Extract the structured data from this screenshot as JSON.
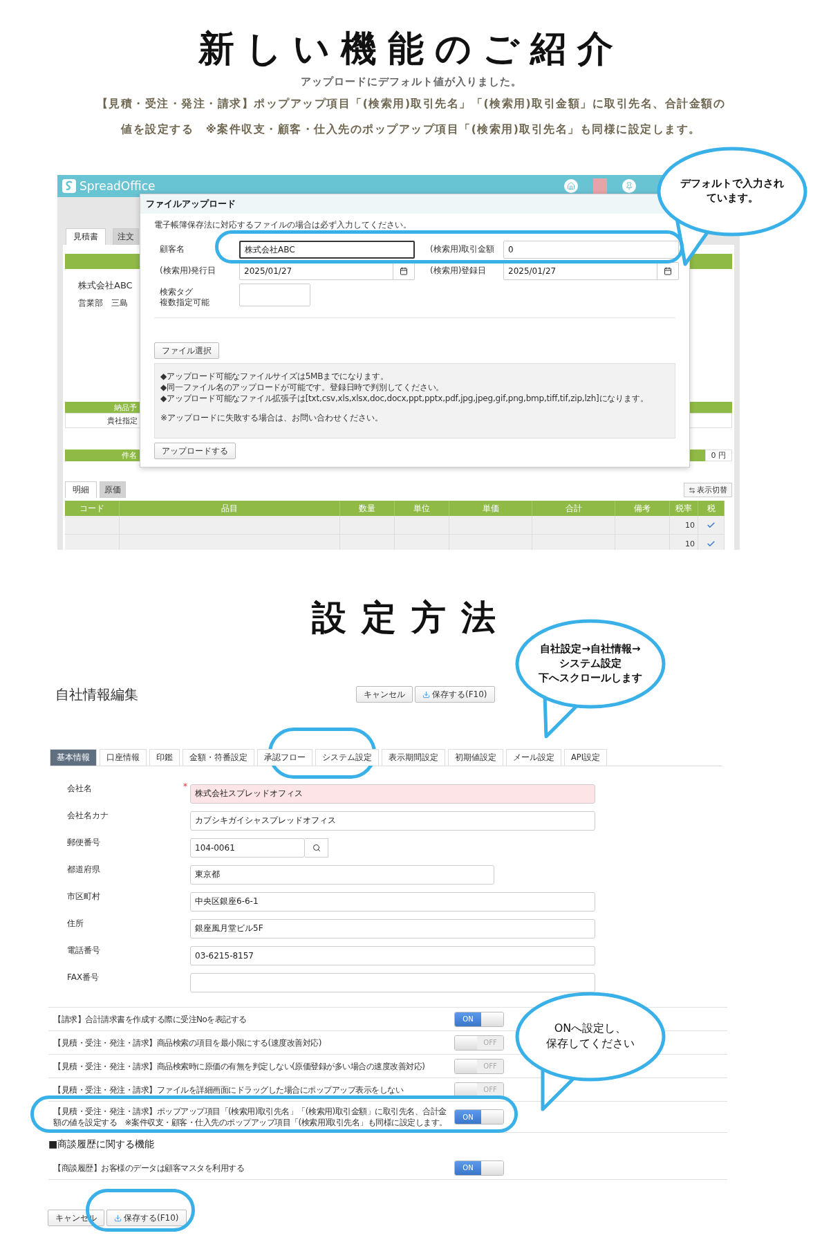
{
  "header": {
    "title": "新しい機能のご紹介",
    "subtitle": "アップロードにデフォルト値が入りました。",
    "description": [
      "【見積・受注・発注・請求】ポップアップ項目「(検索用)取引先名」「(検索用)取引金額」に取引先名、合計金額の",
      "値を設定する　※案件収支・顧客・仕入先のポップアップ項目「(検索用)取引先名」も同様に設定します。"
    ]
  },
  "upload_screenshot": {
    "app": {
      "logo": "SpreadOffice",
      "doc_tabs": [
        {
          "label": "見積書",
          "selected": true
        },
        {
          "label": "注文",
          "selected": false
        }
      ],
      "customer": "株式会社ABC",
      "department": "営業部　三島",
      "delivery_label": "納品予",
      "delivery_value": "貴社指定",
      "subject_label": "件名",
      "amount": "0 円",
      "detail_tabs": [
        {
          "label": "明細",
          "selected": true
        },
        {
          "label": "原価",
          "selected": false
        }
      ],
      "switch_button": "表示切替",
      "table": {
        "columns": [
          "コード",
          "品目",
          "数量",
          "単位",
          "単価",
          "合計",
          "備考",
          "税率",
          "税"
        ],
        "rows": [
          {
            "tax_rate": "10",
            "taxed": true
          },
          {
            "tax_rate": "10",
            "taxed": true
          }
        ]
      }
    },
    "modal": {
      "title": "ファイルアップロード",
      "notice": "電子帳簿保存法に対応するファイルの場合は必ず入力してください。",
      "fields": [
        {
          "kind": "text",
          "label": "顧客名",
          "value": "株式会社ABC",
          "focused": true
        },
        {
          "kind": "text",
          "label": "(検索用)取引金額",
          "value": "0",
          "focused": false
        },
        {
          "kind": "date",
          "label": "(検索用)発行日",
          "value": "2025/01/27",
          "focused": false
        },
        {
          "kind": "date",
          "label": "(検索用)登録日",
          "value": "2025/01/27",
          "focused": false
        },
        {
          "kind": "tag",
          "label_lines": [
            "検索タグ",
            "複数指定可能"
          ],
          "focused": false
        }
      ],
      "file_button": "ファイル選択",
      "info_lines": [
        "◆アップロード可能なファイルサイズは5MBまでになります。",
        "◆同一ファイル名のアップロードが可能です。登録日時で判別してください。",
        "◆アップロード可能なファイル拡張子は[txt,csv,xls,xlsx,doc,docx,ppt,pptx,pdf,jpg,jpeg,gif,png,bmp,tiff,tif,zip,lzh]になります。"
      ],
      "info_note": "※アップロードに失敗する場合は、お問い合わせください。",
      "upload_button": "アップロードする"
    },
    "callout": [
      "デフォルトで入力され",
      "ています。"
    ]
  },
  "section_title": "設定方法",
  "settings_screenshot": {
    "title": "自社情報編集",
    "required_mark": "*",
    "buttons": [
      "キャンセル",
      "保存する(F10)"
    ],
    "tabs": [
      {
        "label": "基本情報",
        "selected": true
      },
      {
        "label": "口座情報",
        "selected": false
      },
      {
        "label": "印鑑",
        "selected": false
      },
      {
        "label": "金額・符番設定",
        "selected": false
      },
      {
        "label": "承認フロー",
        "selected": false
      },
      {
        "label": "システム設定",
        "selected": false
      },
      {
        "label": "表示期間設定",
        "selected": false
      },
      {
        "label": "初期値設定",
        "selected": false
      },
      {
        "label": "メール設定",
        "selected": false
      },
      {
        "label": "API設定",
        "selected": false
      }
    ],
    "form": [
      {
        "kind": "wide",
        "label": "会社名",
        "value": "株式会社スプレッドオフィス",
        "required": true
      },
      {
        "kind": "wide",
        "label": "会社名カナ",
        "value": "カブシキガイシャスプレッドオフィス",
        "required": false
      },
      {
        "kind": "postal",
        "label": "郵便番号",
        "value": "104-0061",
        "required": false
      },
      {
        "kind": "medium",
        "label": "都道府県",
        "value": "東京都",
        "required": false
      },
      {
        "kind": "wide",
        "label": "市区町村",
        "value": "中央区銀座6-6-1",
        "required": false
      },
      {
        "kind": "wide",
        "label": "住所",
        "value": "銀座風月堂ビル5F",
        "required": false
      },
      {
        "kind": "wide",
        "label": "電話番号",
        "value": "03-6215-8157",
        "required": false
      },
      {
        "kind": "wide",
        "label": "FAX番号",
        "required": false
      }
    ],
    "options": [
      {
        "kind": "toggle",
        "label": "【請求】合計請求書を作成する際に受注Noを表記する",
        "on": true,
        "state_label": "ON"
      },
      {
        "kind": "toggle",
        "label": "【見積・受注・発注・請求】商品検索の項目を最小限にする(速度改善対応)",
        "on": false,
        "state_label": "OFF"
      },
      {
        "kind": "toggle",
        "label": "【見積・受注・発注・請求】商品検索時に原価の有無を判定しない(原価登録が多い場合の速度改善対応)",
        "on": false,
        "state_label": "OFF"
      },
      {
        "kind": "toggle",
        "label": "【見積・受注・発注・請求】ファイルを詳細画面にドラッグした場合にポップアップ表示をしない",
        "on": false,
        "state_label": "OFF"
      },
      {
        "kind": "toggle",
        "label": "【見積・受注・発注・請求】ポップアップ項目「(検索用)取引先名」「(検索用)取引金額」に取引先名、合計金額の値を設定する　※案件収支・顧客・仕入先のポップアップ項目「(検索用)取引先名」も同様に設定します。",
        "on": true,
        "state_label": "ON"
      },
      {
        "kind": "heading",
        "label": "■商談履歴に関する機能"
      },
      {
        "kind": "toggle",
        "label": "【商談履歴】お客様のデータは顧客マスタを利用する",
        "on": true,
        "state_label": "ON"
      }
    ],
    "bottom_buttons": [
      "キャンセル",
      "保存する(F10)"
    ],
    "callouts": [
      [
        "自社設定→自社情報→",
        "システム設定",
        "下へスクロールします"
      ],
      [
        "ONへ設定し、",
        "保存してください"
      ]
    ]
  }
}
